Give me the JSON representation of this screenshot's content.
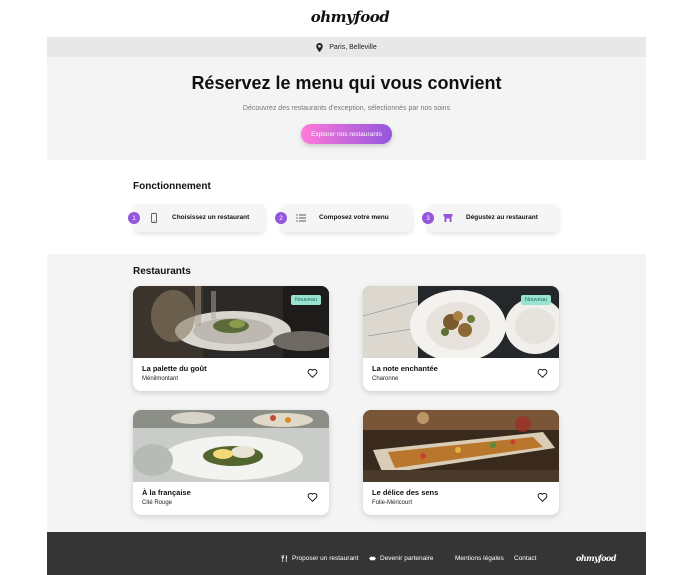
{
  "header": {
    "logo": "ohmyfood"
  },
  "location": {
    "text": "Paris, Belleville",
    "icon": "map-pin-icon"
  },
  "hero": {
    "title": "Réservez le menu qui vous convient",
    "subtitle": "Découvrez des restaurants d'exception, sélectionnés par nos soins",
    "cta_label": "Explorer nos restaurants"
  },
  "how_it_works": {
    "title": "Fonctionnement",
    "steps": [
      {
        "number": "1",
        "label": "Choisissez un restaurant",
        "icon": "mobile-phone-icon"
      },
      {
        "number": "2",
        "label": "Composez votre menu",
        "icon": "list-icon"
      },
      {
        "number": "3",
        "label": "Dégustez au restaurant",
        "icon": "store-icon"
      }
    ]
  },
  "restaurants": {
    "title": "Restaurants",
    "items": [
      {
        "name": "La palette du goût",
        "area": "Ménilmontant",
        "badge": "Nouveau"
      },
      {
        "name": "La note enchantée",
        "area": "Charonne",
        "badge": "Nouveau"
      },
      {
        "name": "À la française",
        "area": "Cité Rouge",
        "badge": ""
      },
      {
        "name": "Le délice des sens",
        "area": "Folie-Méricourt",
        "badge": ""
      }
    ]
  },
  "footer": {
    "propose_label": "Proposer un restaurant",
    "partner_label": "Devenir partenaire",
    "legal_label": "Mentions légales",
    "contact_label": "Contact",
    "logo": "ohmyfood"
  },
  "colors": {
    "accent_start": "#ff79da",
    "accent_end": "#9356dc",
    "badge_bg": "#99e2d0",
    "footer_bg": "#353535"
  }
}
